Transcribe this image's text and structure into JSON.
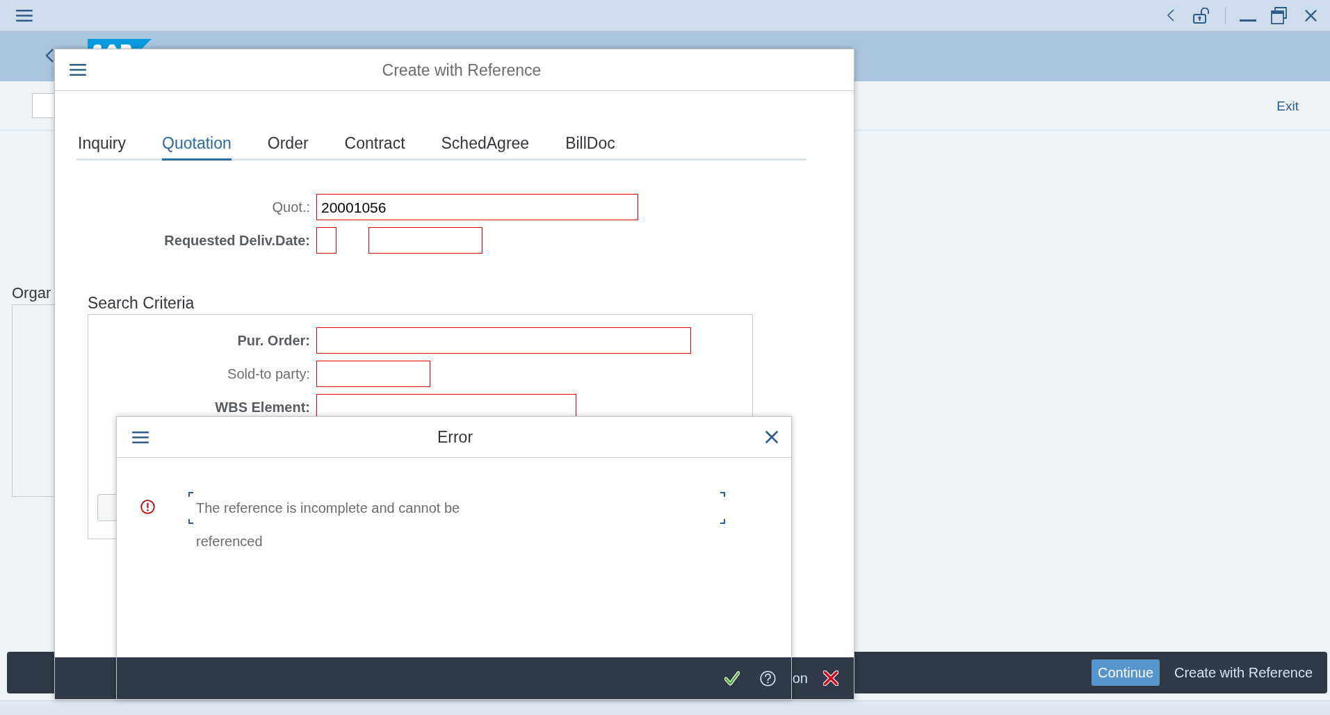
{
  "toolbar": {
    "exit_label": "Exit"
  },
  "background_panel": {
    "title": "Orgar"
  },
  "reference_dialog": {
    "title": "Create with Reference",
    "tabs": [
      {
        "label": "Inquiry",
        "selected": false
      },
      {
        "label": "Quotation",
        "selected": true
      },
      {
        "label": "Order",
        "selected": false
      },
      {
        "label": "Contract",
        "selected": false
      },
      {
        "label": "SchedAgree",
        "selected": false
      },
      {
        "label": "BillDoc",
        "selected": false
      }
    ],
    "fields": [
      {
        "label": "Quot.:",
        "bold": false,
        "kind": "single",
        "invalid": true,
        "value": "20001056"
      },
      {
        "label": "Requested Deliv.Date:",
        "bold": true,
        "kind": "pair",
        "invalid": true
      }
    ],
    "search_criteria": {
      "title": "Search Criteria",
      "fields": [
        {
          "label": "Pur. Order:",
          "bold": true,
          "kind": "single",
          "invalid": true
        },
        {
          "label": "Sold-to party:",
          "bold": false,
          "kind": "single",
          "invalid": true
        },
        {
          "label": "WBS Element:",
          "bold": true,
          "kind": "single",
          "invalid": true
        }
      ]
    },
    "footer": {
      "partial_label": "on"
    }
  },
  "error_dialog": {
    "title": "Error",
    "message_lines": [
      "The reference is incomplete and cannot be",
      "referenced"
    ]
  },
  "footer_bar": {
    "buttons": [
      {
        "label": "Continue",
        "kind": "emphasized"
      },
      {
        "label": "Create with Reference",
        "kind": "transparent"
      }
    ]
  }
}
